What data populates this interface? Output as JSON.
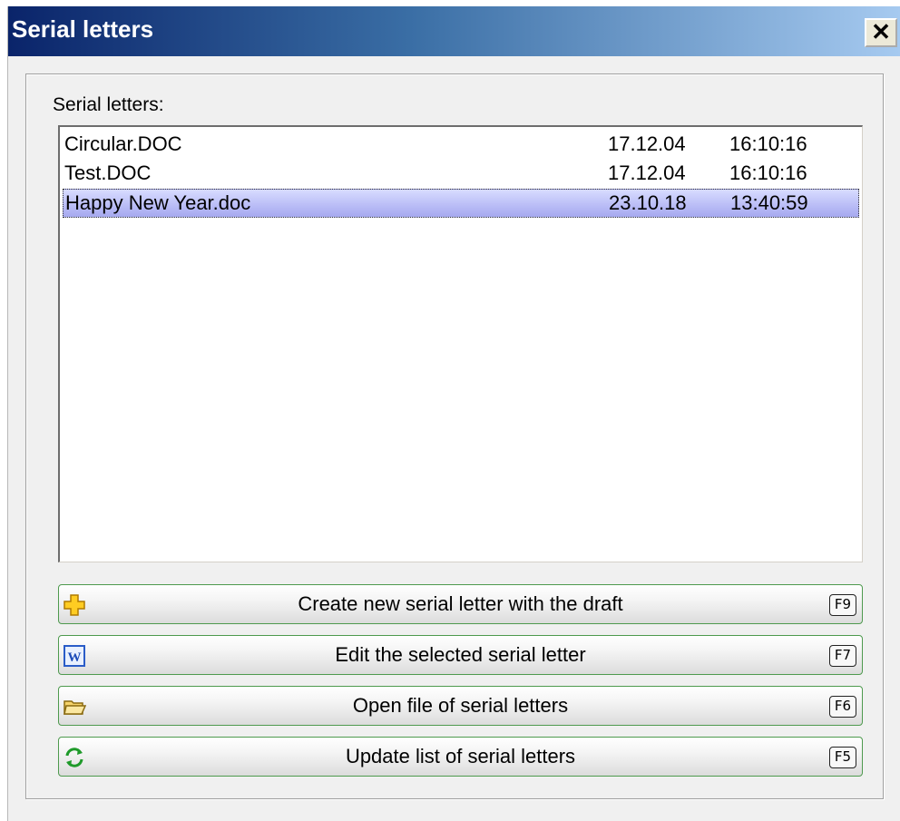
{
  "window": {
    "title": "Serial letters",
    "close_label": "✕"
  },
  "group": {
    "label": "Serial letters:"
  },
  "letters": [
    {
      "name": "Circular.DOC",
      "date": "17.12.04",
      "time": "16:10:16",
      "selected": false
    },
    {
      "name": "Test.DOC",
      "date": "17.12.04",
      "time": "16:10:16",
      "selected": false
    },
    {
      "name": "Happy New Year.doc",
      "date": "23.10.18",
      "time": "13:40:59",
      "selected": true
    }
  ],
  "buttons": [
    {
      "label": "Create new serial letter with the draft",
      "key": "F9",
      "icon": "plus-icon"
    },
    {
      "label": "Edit the selected serial letter",
      "key": "F7",
      "icon": "word-document-icon"
    },
    {
      "label": "Open file of serial letters",
      "key": "F6",
      "icon": "folder-open-icon"
    },
    {
      "label": "Update list of serial letters",
      "key": "F5",
      "icon": "refresh-icon"
    }
  ],
  "colors": {
    "title_gradient_start": "#0a246a",
    "title_gradient_end": "#a6caf0",
    "selection": "#b9bcf6",
    "button_border": "#4e9a4e"
  }
}
